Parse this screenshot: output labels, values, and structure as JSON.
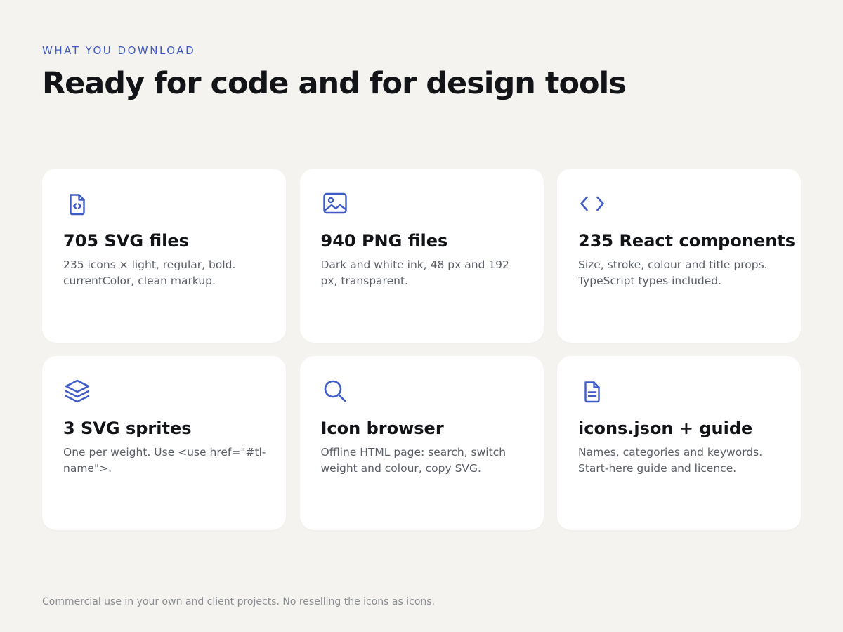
{
  "header": {
    "eyebrow": "WHAT YOU DOWNLOAD",
    "title": "Ready for code and for design tools"
  },
  "accent_color": "#3f5bc7",
  "cards": [
    {
      "icon": "code-file-icon",
      "title": "705 SVG files",
      "description": "235 icons × light, regular, bold. currentColor, clean markup."
    },
    {
      "icon": "image-icon",
      "title": "940 PNG files",
      "description": "Dark and white ink, 48 px and 192 px, transparent."
    },
    {
      "icon": "code-brackets-icon",
      "title": "235 React components",
      "description": "Size, stroke, colour and title props. TypeScript types included."
    },
    {
      "icon": "layers-icon",
      "title": "3 SVG sprites",
      "description": "One per weight. Use <use href=\"#tl-name\">."
    },
    {
      "icon": "search-icon",
      "title": "Icon browser",
      "description": "Offline HTML page: search, switch weight and colour, copy SVG."
    },
    {
      "icon": "document-icon",
      "title": "icons.json + guide",
      "description": "Names, categories and keywords. Start-here guide and licence."
    }
  ],
  "footer": {
    "note": "Commercial use in your own and client projects. No reselling the icons as icons."
  }
}
